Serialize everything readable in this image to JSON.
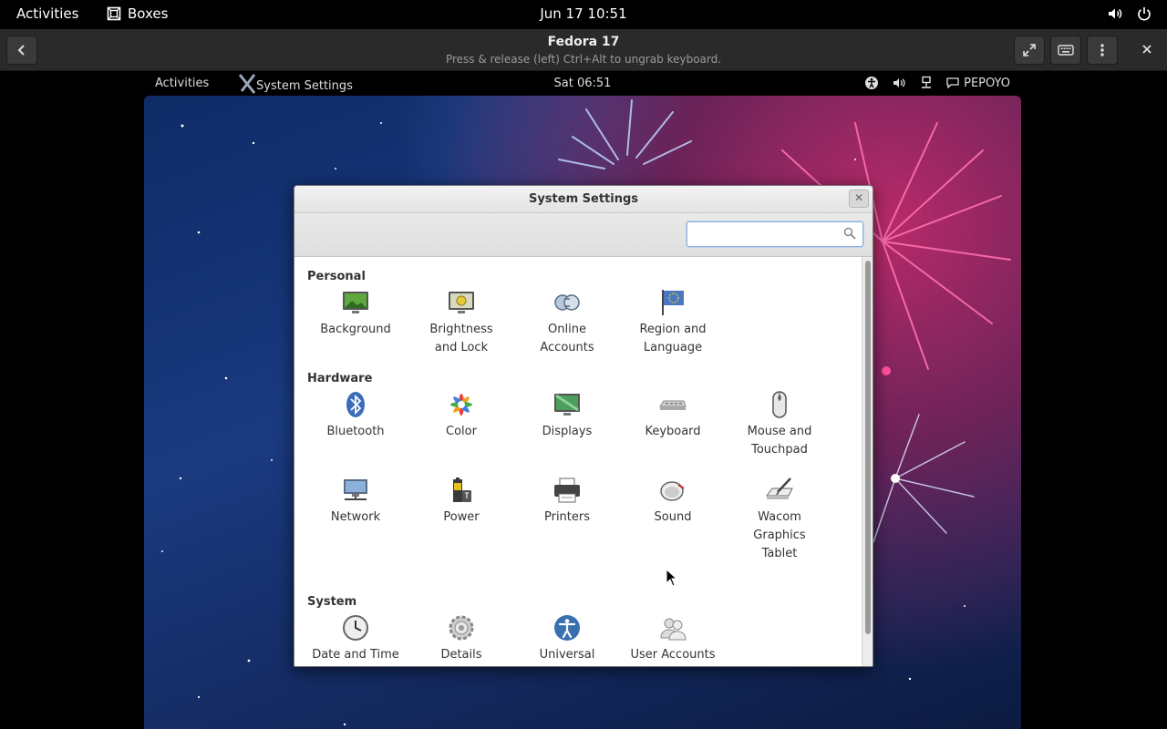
{
  "host": {
    "activities": "Activities",
    "app_name": "Boxes",
    "clock": "Jun 17  10:51"
  },
  "boxes": {
    "title": "Fedora 17",
    "subtitle": "Press & release (left) Ctrl+Alt to ungrab keyboard."
  },
  "guest": {
    "activities": "Activities",
    "app_name": "System Settings",
    "clock": "Sat 06:51",
    "user": "PEPOYO"
  },
  "settings": {
    "title": "System Settings",
    "search_placeholder": "",
    "sections": {
      "personal": "Personal",
      "hardware": "Hardware",
      "system": "System"
    },
    "items": {
      "background": [
        "Background"
      ],
      "brightness": [
        "Brightness",
        "and Lock"
      ],
      "online_accounts": [
        "Online",
        "Accounts"
      ],
      "region": [
        "Region and",
        "Language"
      ],
      "bluetooth": [
        "Bluetooth"
      ],
      "color": [
        "Color"
      ],
      "displays": [
        "Displays"
      ],
      "keyboard": [
        "Keyboard"
      ],
      "mouse": [
        "Mouse and",
        "Touchpad"
      ],
      "network": [
        "Network"
      ],
      "power": [
        "Power"
      ],
      "printers": [
        "Printers"
      ],
      "sound": [
        "Sound"
      ],
      "wacom": [
        "Wacom",
        "Graphics",
        "Tablet"
      ],
      "date_time": [
        "Date and Time"
      ],
      "details": [
        "Details"
      ],
      "universal": [
        "Universal"
      ],
      "user_accounts": [
        "User Accounts"
      ]
    }
  },
  "colors": {
    "host_bg": "#000000",
    "headerbar_bg": "#2a2a2a",
    "window_bg": "#ffffff",
    "accent": "#3a6fb0"
  }
}
